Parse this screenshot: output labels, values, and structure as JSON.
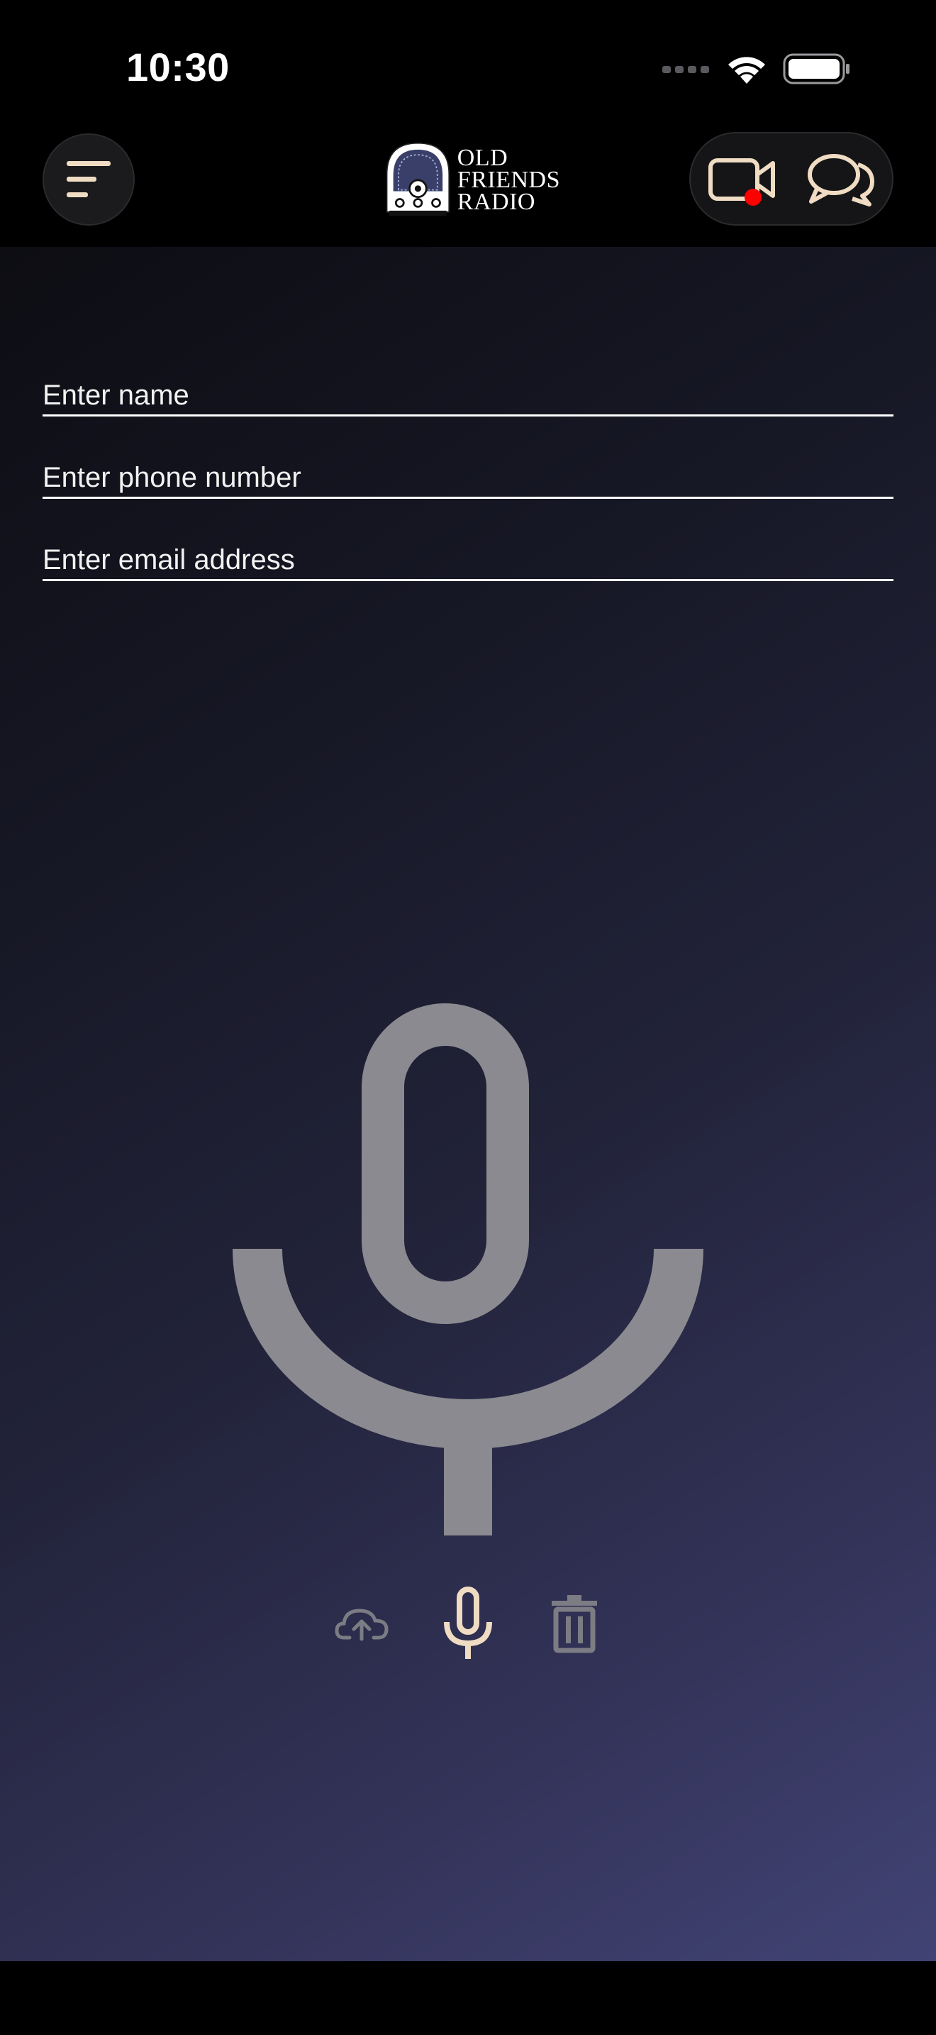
{
  "status_bar": {
    "time": "10:30"
  },
  "header": {
    "logo": {
      "lines": [
        "OLD",
        "FRIENDS",
        "RADIO"
      ]
    },
    "icons": {
      "menu": "menu-icon",
      "video": "video-camera-icon",
      "chat": "chat-bubbles-icon"
    },
    "video_badge_color": "#ff0000"
  },
  "form": {
    "name": {
      "placeholder": "Enter name",
      "value": ""
    },
    "phone": {
      "placeholder": "Enter phone number",
      "value": ""
    },
    "email": {
      "placeholder": "Enter email address",
      "value": ""
    }
  },
  "recorder": {
    "controls": [
      {
        "icon": "cloud-upload-icon"
      },
      {
        "icon": "microphone-icon"
      },
      {
        "icon": "trash-icon"
      }
    ]
  },
  "colors": {
    "accent": "#efdcc3",
    "disabled": "#7c7c84",
    "mic_large": "#8a8a90"
  }
}
